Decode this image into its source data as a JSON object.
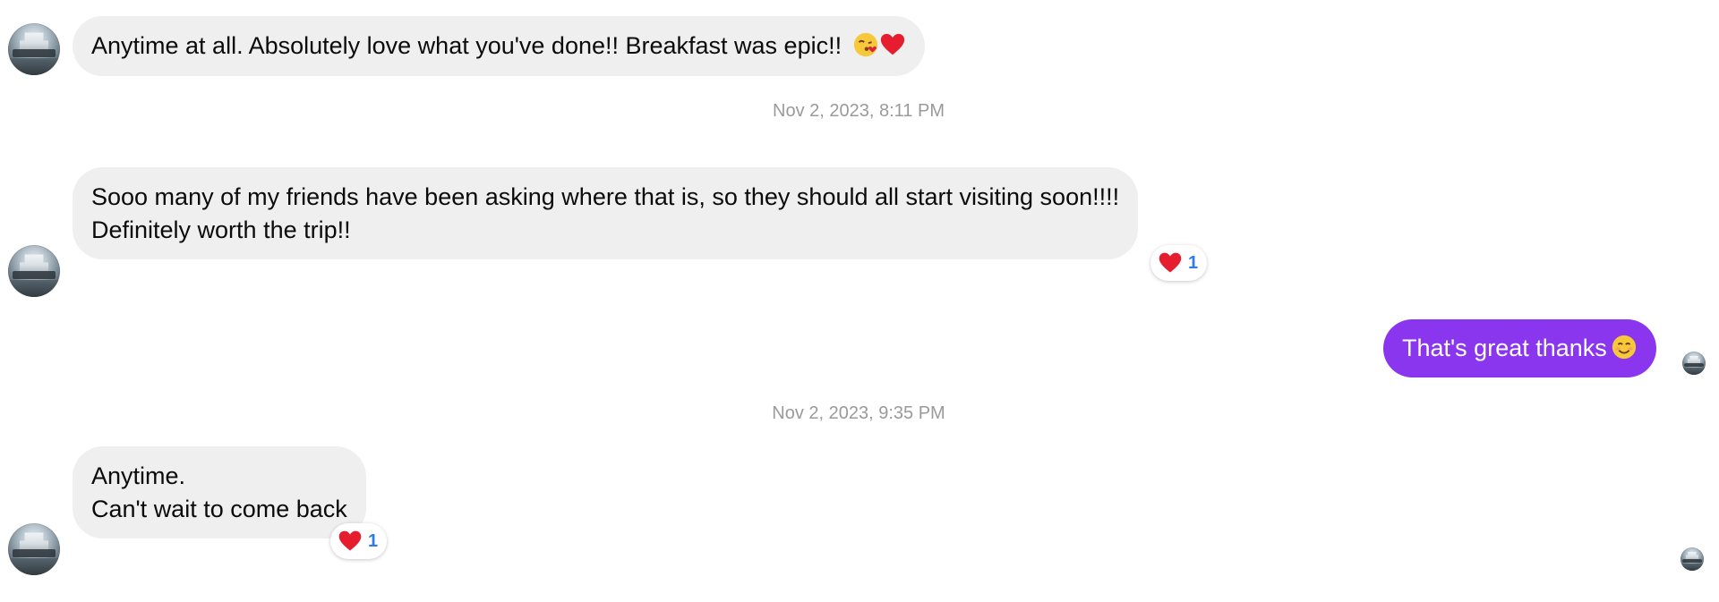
{
  "thread": {
    "messages": [
      {
        "direction": "incoming",
        "lines": [
          "Anytime at all. Absolutely love what you've done!! Breakfast was epic!!"
        ],
        "emojis": [
          "kissing-face-emoji",
          "red-heart-emoji"
        ]
      },
      {
        "direction": "incoming",
        "lines": [
          "Sooo many of my friends have been asking where that is, so they should all start visiting soon!!!!",
          "Definitely worth the trip!!"
        ],
        "reaction": {
          "emoji": "red-heart",
          "count": "1"
        }
      },
      {
        "direction": "outgoing",
        "lines": [
          "That's great thanks"
        ],
        "emojis": [
          "smiling-face-emoji"
        ]
      },
      {
        "direction": "incoming",
        "lines": [
          "Anytime.",
          "Can't wait to come back"
        ],
        "reaction": {
          "emoji": "red-heart",
          "count": "1"
        }
      }
    ],
    "timestamps": [
      "Nov 2, 2023, 8:11 PM",
      "Nov 2, 2023, 9:35 PM"
    ]
  },
  "colors": {
    "incoming_bubble": "#efefef",
    "outgoing_bubble": "#8a35ee",
    "timestamp_text": "#9a9a9a",
    "reaction_count": "#2f7be9"
  }
}
